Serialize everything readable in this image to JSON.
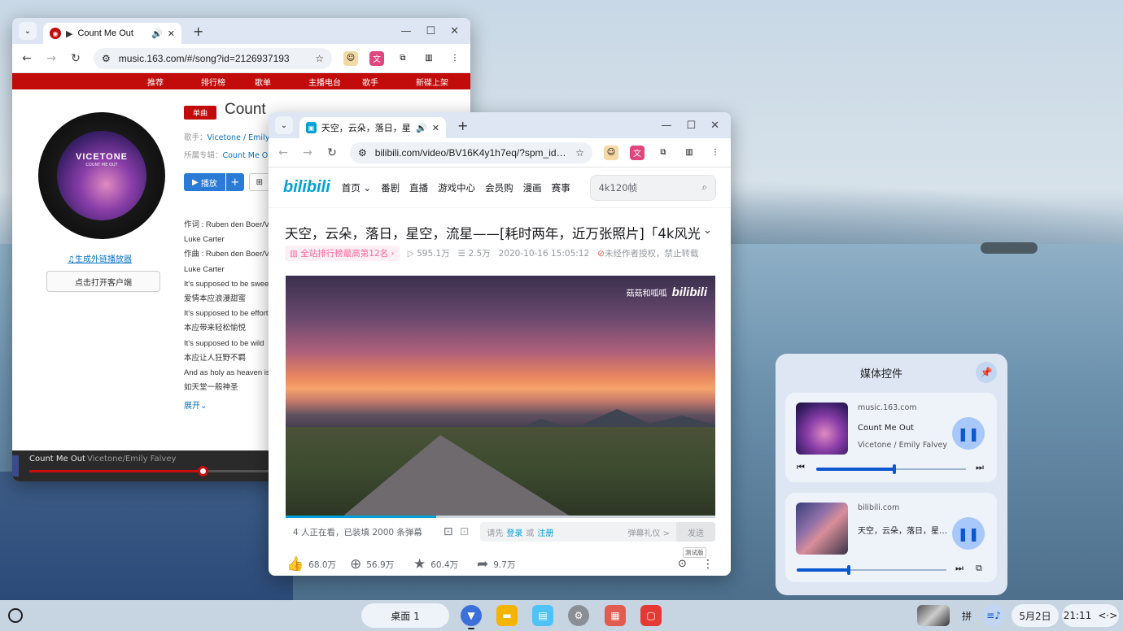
{
  "netease": {
    "tab_title": "Count Me Out",
    "url": "music.163.com/#/song?id=2126937193",
    "nav": [
      "推荐",
      "排行榜",
      "歌单",
      "主播电台",
      "歌手",
      "新碟上架"
    ],
    "badge": "单曲",
    "title": "Count",
    "singer_label": "歌手：",
    "singer_value": "Vicetone / Emily F",
    "album_label": "所属专辑：",
    "album_value": "Count Me Out",
    "play_label": "播放",
    "plus": "+",
    "disc_brand": "VICETONE",
    "disc_sub": "COUNT ME OUT",
    "link_player": "生成外链播放器",
    "open_client": "点击打开客户端",
    "lyrics": [
      "作词 : Ruben den Boer/V",
      "Luke Carter",
      "作曲 : Ruben den Boer/V",
      "Luke Carter",
      "It's supposed to be swee",
      "爱情本应浪漫甜蜜",
      "It's supposed to be effortless",
      "本应带来轻松愉悦",
      "It's supposed to be wild",
      "本应让人狂野不羁",
      "And as holy as heaven is",
      "如天堂一般神圣"
    ],
    "expand": "展开",
    "player_song": "Count Me Out",
    "player_artist": "Vicetone/Emily Falvey",
    "player_progress": 0.71
  },
  "bili": {
    "tab_title": "天空，云朵，落日，星空",
    "url": "bilibili.com/video/BV16K4y1h7eq/?spm_id_from...",
    "logo": "bilibili",
    "nav": [
      "首页",
      "番剧",
      "直播",
      "游戏中心",
      "会员购",
      "漫画",
      "赛事"
    ],
    "search_placeholder": "4k120帧",
    "title": "天空，云朵，落日，星空，流星——[耗时两年，近万张照片]「4k风光...",
    "rank": "全站排行榜最高第12名",
    "views": "595.1万",
    "danmaku_count": "2.5万",
    "date": "2020-10-16 15:05:12",
    "copyright": "未经作者授权，禁止转载",
    "watermark_user": "菇菇和呱呱",
    "watermark_logo": "bilibili",
    "watching": "4 人正在看，已装填 2000 条弹幕",
    "dm_prefix": "请先",
    "dm_login": "登录",
    "dm_or": "或",
    "dm_register": "注册",
    "dm_etiquette": "弹幕礼仪 >",
    "dm_send": "发送",
    "likes": "68.0万",
    "coins": "56.9万",
    "favorites": "60.4万",
    "shares": "9.7万",
    "beta": "测试版",
    "video_progress": 0.35
  },
  "media_panel": {
    "title": "媒体控件",
    "items": [
      {
        "source": "music.163.com",
        "song": "Count Me Out",
        "artist": "Vicetone / Emily Falvey",
        "progress": 0.52
      },
      {
        "source": "bilibili.com",
        "song": "天空，云朵，落日，星空...",
        "artist": "",
        "progress": 0.35
      }
    ]
  },
  "shelf": {
    "desk": "桌面 1",
    "ime": "拼",
    "date": "5月2日",
    "time": "21:11",
    "time_suffix": "<·>"
  },
  "colors": {
    "netease_red": "#c20c0c",
    "bili_blue": "#00a1d6",
    "bili_pink": "#ff6699",
    "chrome_accent": "#0b57d0"
  }
}
